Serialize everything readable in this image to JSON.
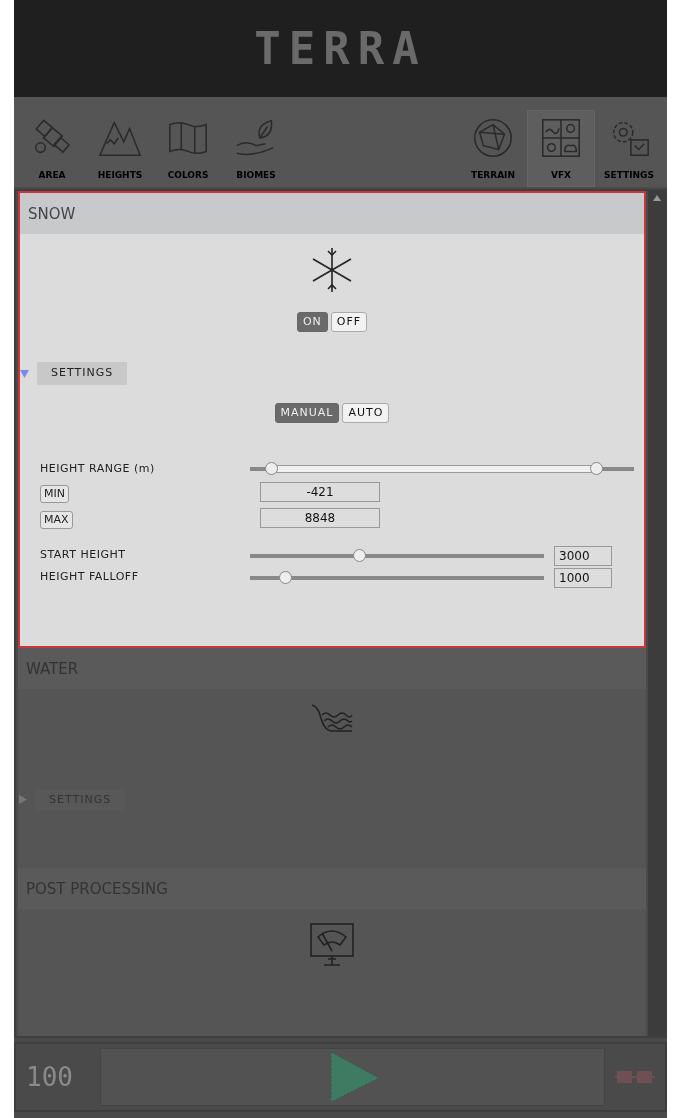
{
  "logo": "TERRA",
  "tools": [
    {
      "label": "AREA",
      "kind": "area",
      "selected": false
    },
    {
      "label": "HEIGHTS",
      "kind": "heights",
      "selected": false
    },
    {
      "label": "COLORS",
      "kind": "colors",
      "selected": false
    },
    {
      "label": "BIOMES",
      "kind": "biomes",
      "selected": false
    },
    {
      "label": "TERRAIN",
      "kind": "terrain",
      "selected": false
    },
    {
      "label": "VFX",
      "kind": "vfx",
      "selected": true
    },
    {
      "label": "SETTINGS",
      "kind": "settings",
      "selected": false
    }
  ],
  "sections": [
    {
      "title": "SNOW",
      "kind": "snow",
      "focused": true,
      "toggle": [
        {
          "label": "ON",
          "selected": true
        },
        {
          "label": "OFF",
          "selected": false
        }
      ],
      "settings": {
        "label": "SETTINGS",
        "expanded": true,
        "mode": [
          {
            "label": "MANUAL",
            "selected": true
          },
          {
            "label": "AUTO",
            "selected": false
          }
        ],
        "height_range": {
          "label": "HEIGHT RANGE (m)",
          "thumbs": [
            {
              "level": 0.054
            },
            {
              "level": 0.9
            }
          ],
          "min_label": "MIN",
          "min_value": "-421",
          "max_label": "MAX",
          "max_value": "8848"
        },
        "sliders": [
          {
            "label": "START HEIGHT",
            "level": 0.37,
            "value": "3000"
          },
          {
            "label": "HEIGHT FALLOFF",
            "level": 0.12,
            "value": "1000"
          }
        ]
      }
    },
    {
      "title": "WATER",
      "kind": "water",
      "focused": false,
      "settings": {
        "label": "SETTINGS",
        "expanded": false
      }
    },
    {
      "title": "POST PROCESSING",
      "kind": "post",
      "focused": false
    }
  ],
  "footer": {
    "counter": "100"
  }
}
